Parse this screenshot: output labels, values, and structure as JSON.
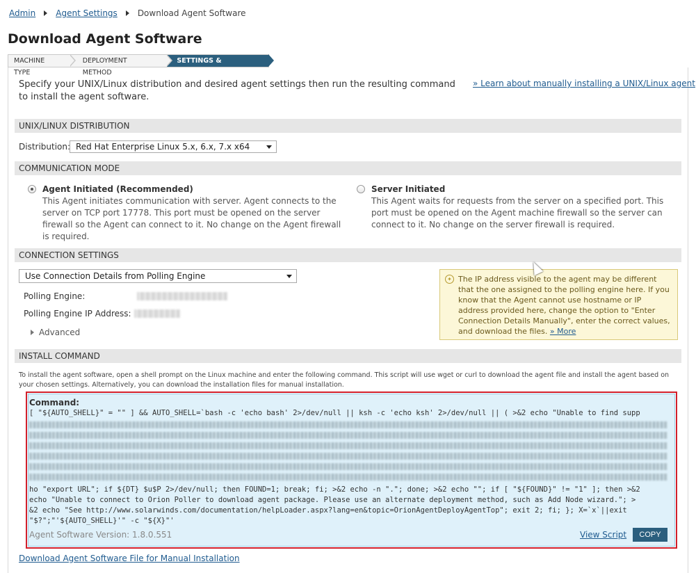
{
  "breadcrumb": {
    "items": [
      "Admin",
      "Agent Settings"
    ],
    "current": "Download Agent Software"
  },
  "page_title": "Download Agent Software",
  "wizard": {
    "steps": [
      "MACHINE TYPE",
      "DEPLOYMENT METHOD",
      "SETTINGS & FILES/URLS"
    ],
    "active_index": 2
  },
  "intro": {
    "text": "Specify your UNIX/Linux distribution and desired agent settings then run the resulting command to install the agent software.",
    "link": "» Learn about manually installing a UNIX/Linux agent"
  },
  "distribution": {
    "header": "UNIX/LINUX DISTRIBUTION",
    "label": "Distribution:",
    "value": "Red Hat Enterprise Linux 5.x, 6.x, 7.x x64"
  },
  "communication": {
    "header": "COMMUNICATION MODE",
    "options": [
      {
        "title": "Agent Initiated (Recommended)",
        "desc": "This Agent initiates communication with server. Agent connects to the server on TCP port 17778. This port must be opened on the server firewall so the Agent can connect to it. No change on the Agent firewall is required.",
        "checked": true
      },
      {
        "title": "Server Initiated",
        "desc": "This Agent waits for requests from the server on a specified port. This port must be opened on the Agent machine firewall so the server can connect to it. No change on the server firewall is required.",
        "checked": false
      }
    ]
  },
  "connection": {
    "header": "CONNECTION SETTINGS",
    "select_value": "Use Connection Details from Polling Engine",
    "polling_engine_label": "Polling Engine:",
    "polling_ip_label": "Polling Engine IP Address:",
    "advanced": "Advanced",
    "tip": "The IP address visible to the agent may be different that the one assigned to the polling engine here. If you know that the Agent cannot use hostname or IP address provided here, change the option to \"Enter Connection Details Manually\", enter the correct values, and download the files.",
    "tip_more": "» More"
  },
  "install": {
    "header": "INSTALL COMMAND",
    "text": "To install the agent software, open a shell prompt on the Linux machine and enter the following command. This script will use wget or curl to download the agent file and install the agent based on your chosen settings. Alternatively, you can download the installation files for manual installation.",
    "command_label": "Command:",
    "line_first": "[ \"${AUTO_SHELL}\" = \"\" ] && AUTO_SHELL=`bash -c 'echo bash' 2>/dev/null || ksh -c 'echo ksh' 2>/dev/null || ( >&2 echo \"Unable to find supp",
    "line_a": "ho \"export URL\"; if ${DT} $u$P 2>/dev/null; then FOUND=1; break; fi; >&2 echo -n \".\"; done; >&2 echo \"\"; if [ \"${FOUND}\" != \"1\" ]; then >&2",
    "line_b": " echo \"Unable to connect to Orion Poller to download agent package. Please use an alternate deployment method, such as Add Node wizard.\"; >",
    "line_c": "&2 echo \"See http://www.solarwinds.com/documentation/helpLoader.aspx?lang=en&topic=OrionAgentDeployAgentTop\"; exit 2; fi; }; X=`x`||exit",
    "line_d": " \"$?\";\"'${AUTO_SHELL}'\" -c \"${X}\"'",
    "version": "Agent Software Version: 1.8.0.551",
    "view_script": "View Script",
    "copy": "COPY"
  },
  "download_link": "Download Agent Software File for Manual Installation"
}
